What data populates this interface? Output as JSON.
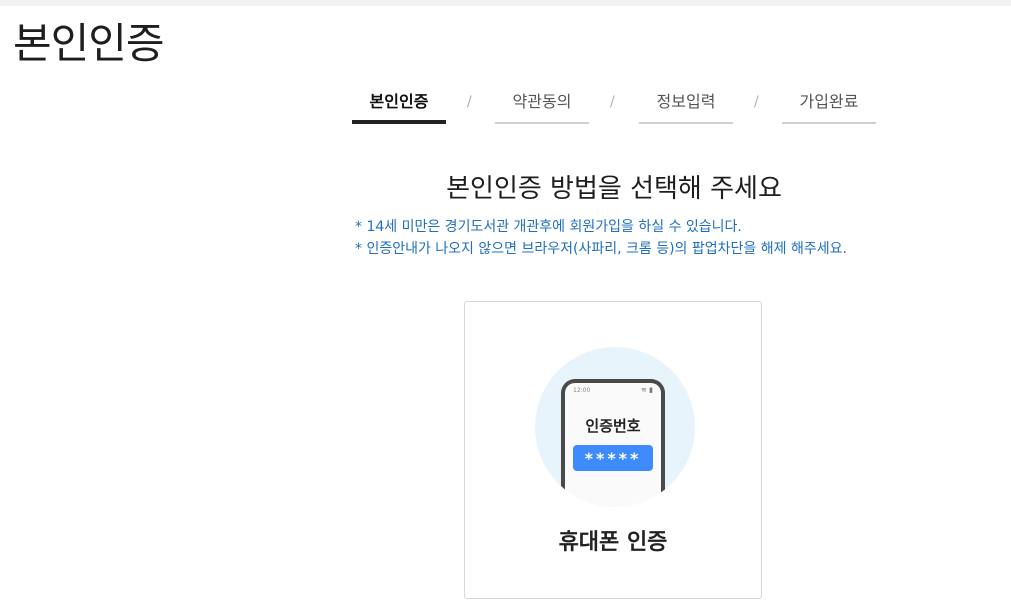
{
  "page": {
    "title": "본인인증"
  },
  "steps": [
    {
      "label": "본인인증",
      "active": true
    },
    {
      "label": "약관동의",
      "active": false
    },
    {
      "label": "정보입력",
      "active": false
    },
    {
      "label": "가입완료",
      "active": false
    }
  ],
  "step_separator": "/",
  "main": {
    "heading": "본인인증 방법을 선택해 주세요",
    "notices": [
      "* 14세 미만은 경기도서관 개관후에 회원가입을 하실 수 있습니다.",
      "* 인증안내가 나오지 않으면 브라우저(사파리, 크롬 등)의 팝업차단을 해제 해주세요."
    ]
  },
  "auth_card": {
    "label": "휴대폰 인증",
    "illustration": {
      "status_time": "12:00",
      "phone_label": "인증번호",
      "code_mask": "*****"
    },
    "icons": [
      "phone-icon",
      "wifi-icon",
      "battery-icon"
    ]
  },
  "colors": {
    "notice": "#1f6fbf",
    "code_box": "#3d8bfd",
    "circle_bg": "#e8f4fc",
    "active_step_underline": "#222222"
  }
}
